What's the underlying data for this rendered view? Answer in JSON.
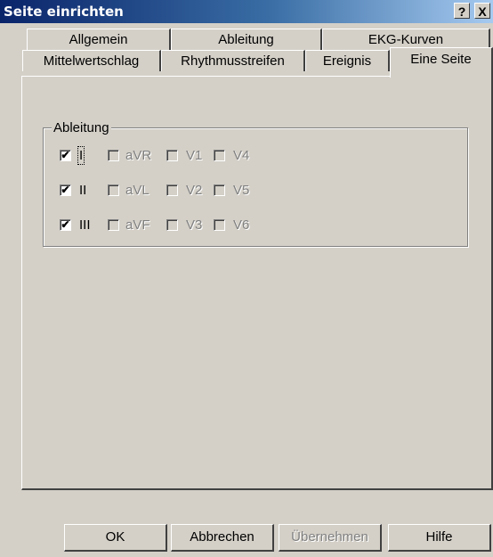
{
  "window": {
    "title": "Seite einrichten",
    "help_button": "?",
    "close_button": "X"
  },
  "tabs": {
    "row_back": [
      "Allgemein",
      "Ableitung",
      "EKG-Kurven"
    ],
    "row_front": [
      "Mittelwertschlag",
      "Rhythmusstreifen",
      "Ereignis",
      "Eine Seite"
    ],
    "active": "Eine Seite"
  },
  "group": {
    "label": "Ableitung",
    "leads": [
      {
        "label": "I",
        "checked": true,
        "enabled": true
      },
      {
        "label": "aVR",
        "checked": false,
        "enabled": false
      },
      {
        "label": "V1",
        "checked": false,
        "enabled": false
      },
      {
        "label": "V4",
        "checked": false,
        "enabled": false
      },
      {
        "label": "II",
        "checked": true,
        "enabled": true
      },
      {
        "label": "aVL",
        "checked": false,
        "enabled": false
      },
      {
        "label": "V2",
        "checked": false,
        "enabled": false
      },
      {
        "label": "V5",
        "checked": false,
        "enabled": false
      },
      {
        "label": "III",
        "checked": true,
        "enabled": true
      },
      {
        "label": "aVF",
        "checked": false,
        "enabled": false
      },
      {
        "label": "V3",
        "checked": false,
        "enabled": false
      },
      {
        "label": "V6",
        "checked": false,
        "enabled": false
      }
    ]
  },
  "buttons": {
    "ok": "OK",
    "cancel": "Abbrechen",
    "apply": "Übernehmen",
    "help": "Hilfe"
  },
  "colors": {
    "titlebar_start": "#0a246a",
    "titlebar_end": "#a6caf0",
    "face": "#d4d0c8",
    "disabled_text": "#808080"
  }
}
